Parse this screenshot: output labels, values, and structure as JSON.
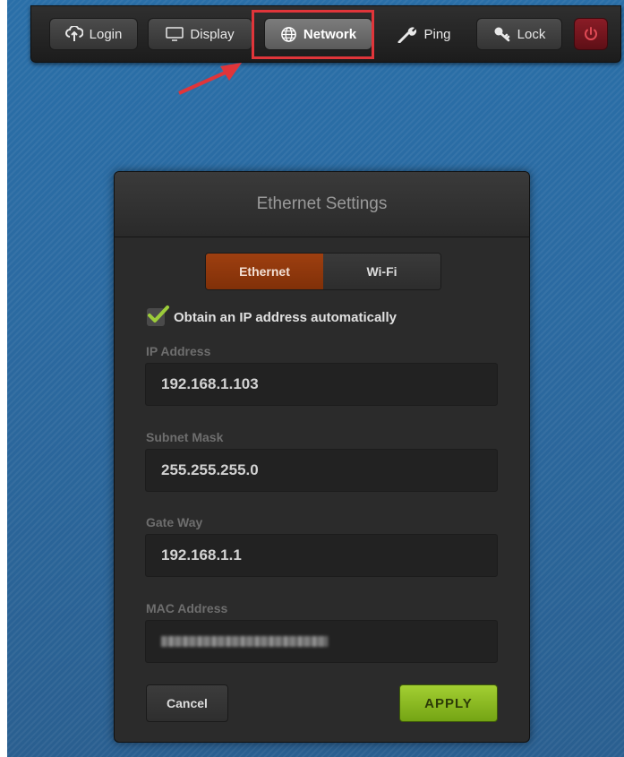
{
  "toolbar": {
    "items": [
      {
        "label": "Login",
        "icon": "cloud-upload-icon"
      },
      {
        "label": "Display",
        "icon": "monitor-icon"
      },
      {
        "label": "Network",
        "icon": "globe-icon",
        "active": true
      },
      {
        "label": "Ping",
        "icon": "wrench-icon"
      },
      {
        "label": "Lock",
        "icon": "key-icon"
      },
      {
        "label": "",
        "icon": "power-icon"
      }
    ]
  },
  "dialog": {
    "title": "Ethernet Settings",
    "tabs": [
      {
        "label": "Ethernet",
        "selected": true
      },
      {
        "label": "Wi-Fi",
        "selected": false
      }
    ],
    "auto_ip": {
      "label": "Obtain an IP address automatically",
      "checked": true
    },
    "fields": {
      "ip": {
        "label": "IP Address",
        "value": "192.168.1.103"
      },
      "subnet": {
        "label": "Subnet Mask",
        "value": "255.255.255.0"
      },
      "gateway": {
        "label": "Gate Way",
        "value": "192.168.1.1"
      },
      "mac": {
        "label": "MAC Address",
        "value": "",
        "obscured": true
      }
    },
    "cancel_label": "Cancel",
    "apply_label": "APPLY"
  },
  "colors": {
    "accent_tab": "#9e3f10",
    "apply_green": "#8fbe26",
    "highlight_red": "#e0353a",
    "power_red": "#8a1c26"
  }
}
